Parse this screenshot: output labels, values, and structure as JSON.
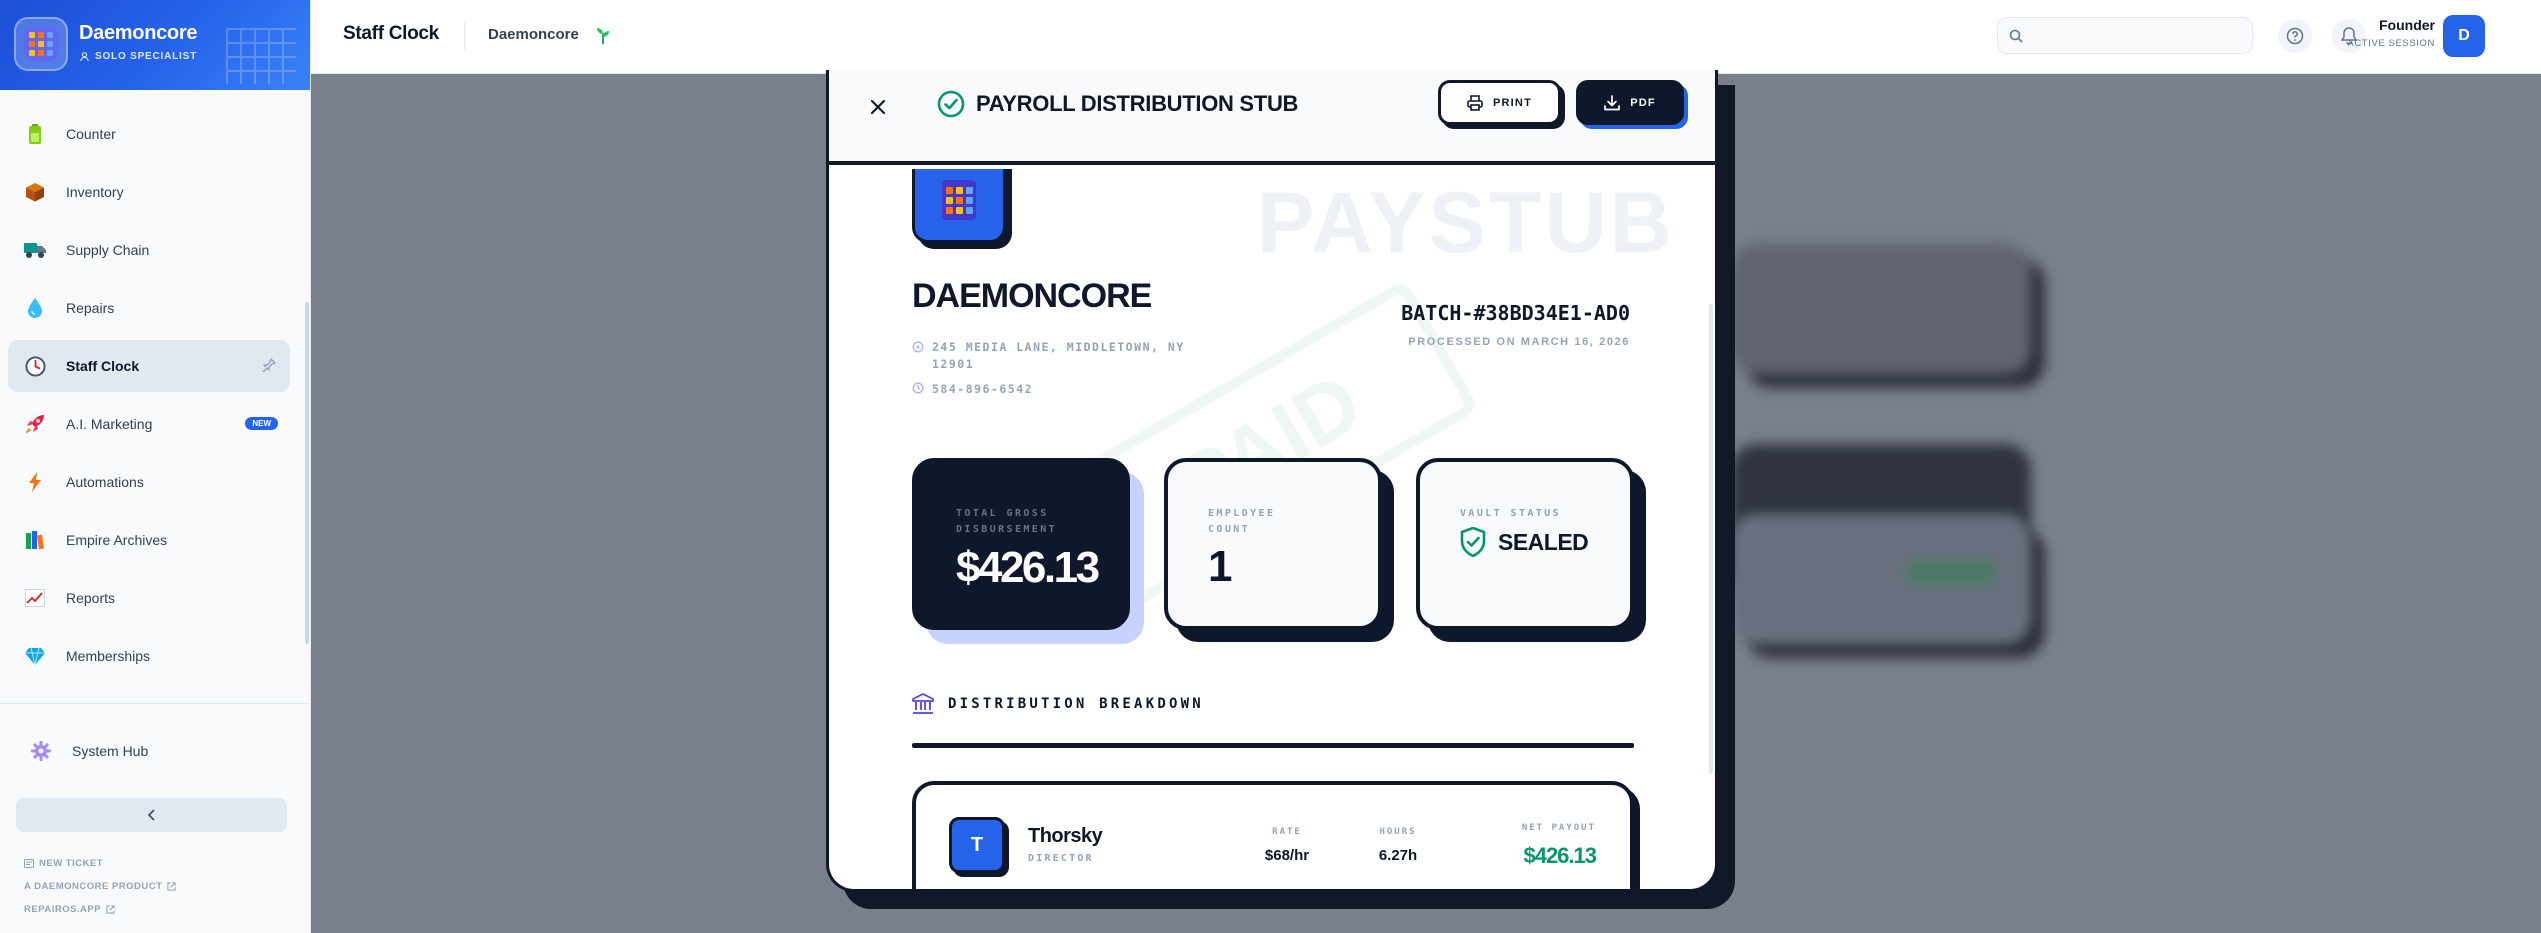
{
  "colors": {
    "brand": "#2563eb",
    "ink": "#0f172a",
    "positive": "#059669",
    "accent_shadow": "#c7d2fe"
  },
  "sidebar": {
    "brand_name": "Daemoncore",
    "brand_role": "SOLO SPECIALIST",
    "items": [
      {
        "label": "Counter",
        "icon": "battery-icon"
      },
      {
        "label": "Inventory",
        "icon": "package-icon"
      },
      {
        "label": "Supply Chain",
        "icon": "truck-icon"
      },
      {
        "label": "Repairs",
        "icon": "droplet-icon"
      },
      {
        "label": "Staff Clock",
        "icon": "clock-icon",
        "active": true
      },
      {
        "label": "A.I. Marketing",
        "icon": "rocket-icon",
        "badge": "NEW"
      },
      {
        "label": "Automations",
        "icon": "lightning-icon"
      },
      {
        "label": "Empire Archives",
        "icon": "books-icon"
      },
      {
        "label": "Reports",
        "icon": "chart-icon"
      },
      {
        "label": "Memberships",
        "icon": "gem-icon"
      }
    ],
    "system_hub": "System Hub",
    "footer": {
      "ticket": "NEW TICKET",
      "product": "A DAEMONCORE PRODUCT",
      "site": "REPAIROS.APP"
    }
  },
  "topbar": {
    "title": "Staff Clock",
    "company": "Daemoncore",
    "search_placeholder": "",
    "user_name": "Founder",
    "user_session": "ACTIVE SESSION",
    "avatar_initial": "D"
  },
  "modal": {
    "title": "PAYROLL DISTRIBUTION STUB",
    "print_label": "PRINT",
    "pdf_label": "PDF",
    "watermark": "PAYSTUB",
    "stamp": "PAID",
    "company_name": "DAEMONCORE",
    "address": "245 MEDIA LANE, MIDDLETOWN, NY 12901",
    "phone": "584-896-6542",
    "batch": "BATCH-#38BD34E1-AD0",
    "processed": "PROCESSED ON MARCH 16, 2026",
    "cards": {
      "gross_label": "TOTAL GROSS DISBURSEMENT",
      "gross_value": "$426.13",
      "employee_label": "EMPLOYEE COUNT",
      "employee_value": "1",
      "vault_label": "VAULT STATUS",
      "vault_value": "SEALED"
    },
    "breakdown_title": "DISTRIBUTION BREAKDOWN",
    "employees": [
      {
        "initial": "T",
        "name": "Thorsky",
        "role": "DIRECTOR",
        "rate_label": "RATE",
        "rate": "$68/hr",
        "hours_label": "HOURS",
        "hours": "6.27h",
        "net_label": "NET PAYOUT",
        "net": "$426.13"
      }
    ]
  }
}
